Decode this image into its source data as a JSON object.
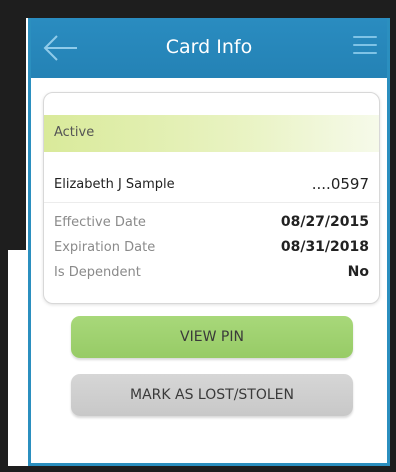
{
  "header": {
    "title": "Card Info",
    "back_icon": "arrow-left-icon",
    "menu_icon": "hamburger-menu-icon"
  },
  "card": {
    "status": "Active",
    "holder_name": "Elizabeth J Sample",
    "number_masked": "....0597",
    "rows": [
      {
        "label": "Effective Date",
        "value": "08/27/2015"
      },
      {
        "label": "Expiration Date",
        "value": "08/31/2018"
      },
      {
        "label": "Is Dependent",
        "value": "No"
      }
    ]
  },
  "actions": {
    "view_pin": "VIEW PIN",
    "mark_lost": "MARK AS LOST/STOLEN"
  },
  "colors": {
    "header_blue": "#2a8cc0",
    "status_green": "#d9ea9a",
    "pin_button_green": "#a8d87a",
    "lost_button_gray": "#cfcfcf"
  }
}
